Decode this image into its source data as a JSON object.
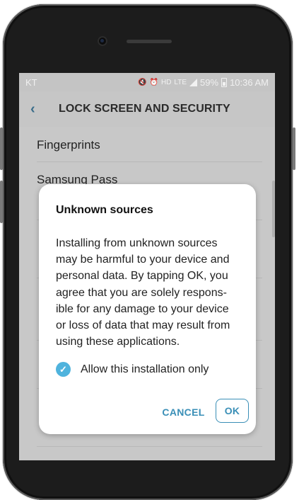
{
  "status_bar": {
    "carrier": "KT",
    "icons": [
      "mute-icon",
      "alarm-icon",
      "hd-icon",
      "lte-icon",
      "signal-icon"
    ],
    "lte": "LTE",
    "battery_percent": "59%",
    "time": "10:36 AM"
  },
  "app_bar": {
    "title": "LOCK SCREEN AND SECURITY"
  },
  "settings_list": [
    {
      "title": "Fingerprints"
    },
    {
      "title": "Samsung Pass"
    }
  ],
  "dialog": {
    "title": "Unknown sources",
    "body_lines": [
      "Installing from unknown sources",
      "may be harmful to your device and",
      "personal data. By tapping OK, you",
      "agree that you are solely respons-",
      "ible for any damage to your device",
      "or loss of data that may result from",
      "using these applications."
    ],
    "checkbox": {
      "label": "Allow this installation only",
      "checked": true
    },
    "cancel_label": "CANCEL",
    "ok_label": "OK"
  },
  "colors": {
    "accent": "#3a8fb7",
    "checkbox": "#4fb3dd",
    "dim_overlay": "#c8c8c8"
  }
}
